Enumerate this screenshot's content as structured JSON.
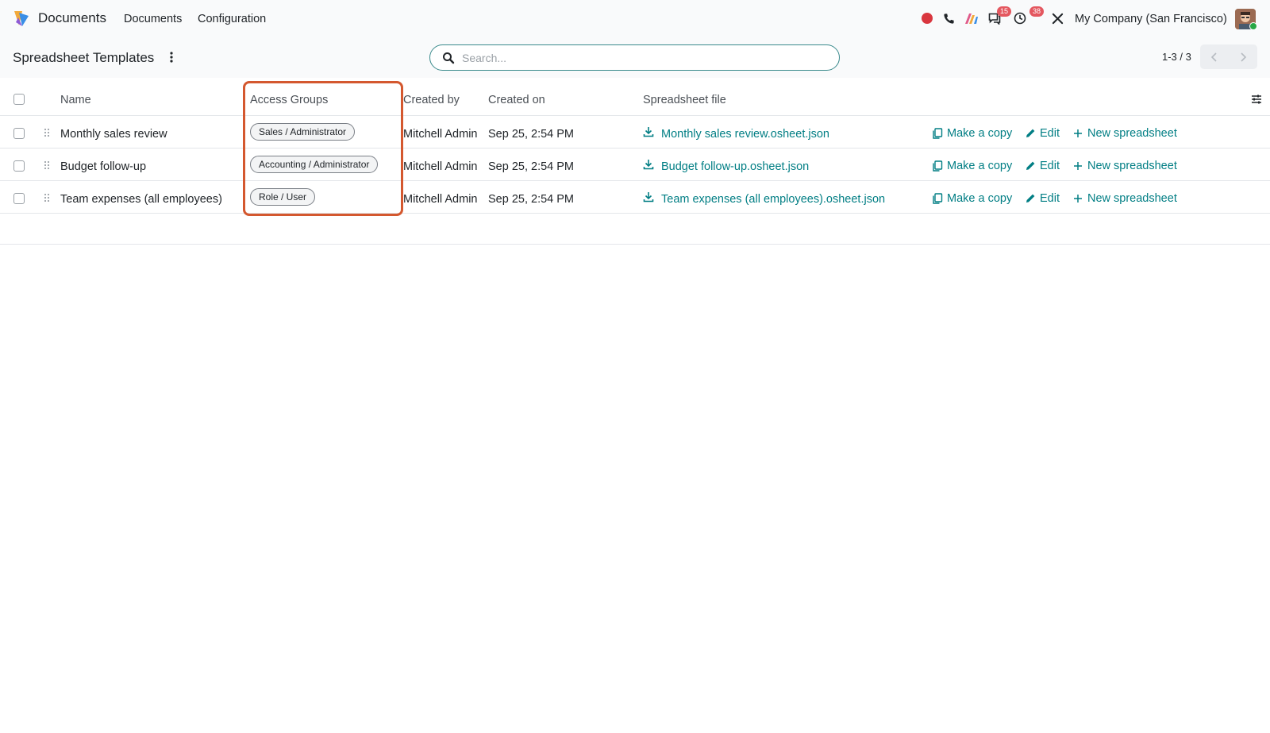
{
  "navbar": {
    "app_name": "Documents",
    "menu": [
      "Documents",
      "Configuration"
    ],
    "messages_count": "15",
    "activities_count": "38",
    "company": "My Company (San Francisco)"
  },
  "control_panel": {
    "title": "Spreadsheet Templates",
    "search_placeholder": "Search...",
    "pager": "1-3 / 3"
  },
  "list": {
    "columns": {
      "name": "Name",
      "access_groups": "Access Groups",
      "created_by": "Created by",
      "created_on": "Created on",
      "spreadsheet_file": "Spreadsheet file"
    },
    "actions": {
      "make_copy": "Make a copy",
      "edit": "Edit",
      "new_spreadsheet": "New spreadsheet"
    },
    "rows": [
      {
        "name": "Monthly sales review",
        "group": "Sales / Administrator",
        "created_by": "Mitchell Admin",
        "created_on": "Sep 25, 2:54 PM",
        "file": "Monthly sales review.osheet.json"
      },
      {
        "name": "Budget follow-up",
        "group": "Accounting / Administrator",
        "created_by": "Mitchell Admin",
        "created_on": "Sep 25, 2:54 PM",
        "file": "Budget follow-up.osheet.json"
      },
      {
        "name": "Team expenses (all employees)",
        "group": "Role / User",
        "created_by": "Mitchell Admin",
        "created_on": "Sep 25, 2:54 PM",
        "file": "Team expenses (all employees).osheet.json"
      }
    ]
  },
  "colors": {
    "accent_link": "#017e84",
    "highlight": "#d4582f",
    "badge": "#e4575f"
  }
}
